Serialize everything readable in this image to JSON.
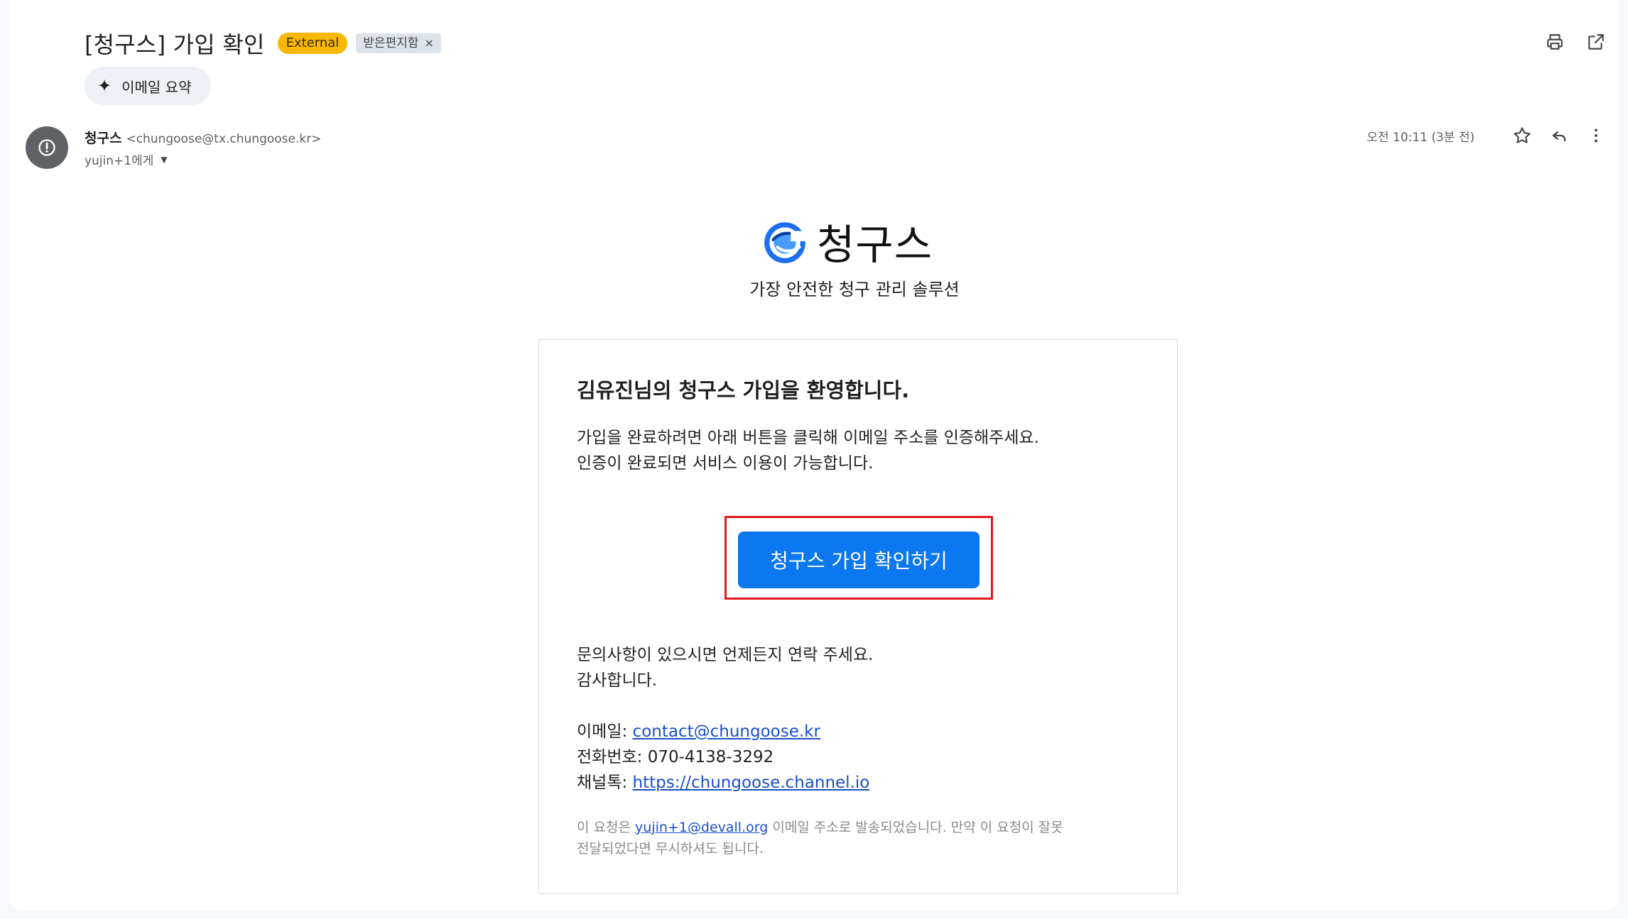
{
  "header": {
    "subject": "[청구스] 가입 확인",
    "tag_external": "External",
    "tag_inbox": "받은편지함",
    "tag_remove": "×",
    "summary_label": "이메일 요약",
    "icons": [
      "print-icon",
      "open-in-new-icon"
    ]
  },
  "sender": {
    "name": "청구스",
    "email": "<chungoose@tx.chungoose.kr>",
    "to": "yujin+1에게",
    "time": "오전 10:11 (3분 전)",
    "icons": [
      "star-icon",
      "reply-icon",
      "more-vert-icon"
    ]
  },
  "brand": {
    "name": "청구스",
    "tagline": "가장 안전한 청구 관리 솔루션",
    "logo_color": "#1e6ff0"
  },
  "card": {
    "title": "김유진님의 청구스 가입을 환영합니다.",
    "text_line1": "가입을 완료하려면 아래 버튼을 클릭해 이메일 주소를 인증해주세요.",
    "text_line2": "인증이 완료되면 서비스 이용이 가능합니다.",
    "cta_label": "청구스 가입 확인하기",
    "contact_line1": "문의사항이 있으시면 언제든지 연락 주세요.",
    "contact_line2": "감사합니다.",
    "email_label": "이메일: ",
    "email_value": "contact@chungoose.kr",
    "phone_label": "전화번호: ",
    "phone_value": "070-4138-3292",
    "channel_label": "채널톡: ",
    "channel_value": "https://chungoose.channel.io",
    "foot_prefix": "이 요청은 ",
    "foot_email": "yujin+1@devall.org",
    "foot_suffix_1": " 이메일 주소로 발송되었습니다. 만약 이 요청이 잘못",
    "foot_line2": "전달되었다면 무시하셔도 됩니다."
  },
  "colors": {
    "cta": "#0b78f2",
    "highlight": "#e0191e",
    "external_tag": "#f9b800",
    "link": "#1a4fc9"
  }
}
